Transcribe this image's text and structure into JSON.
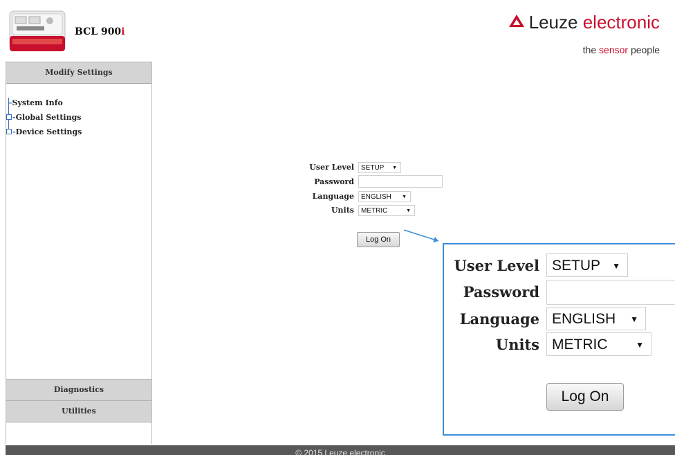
{
  "header": {
    "product_name": "BCL 900",
    "product_slash": "i",
    "device_image": "device-image",
    "brand_name": "Leuze",
    "brand_accent": "electronic",
    "tagline_pre": "the ",
    "tagline_accent": "sensor",
    "tagline_post": " people",
    "brand_color": "#c8102e"
  },
  "sidebar": {
    "modify_settings": "Modify Settings",
    "tree": [
      {
        "label": "System Info"
      },
      {
        "label": "Global Settings"
      },
      {
        "label": "Device Settings"
      }
    ],
    "diagnostics": "Diagnostics",
    "utilities": "Utilities"
  },
  "login": {
    "user_level_label": "User Level",
    "user_level_value": "SETUP",
    "password_label": "Password",
    "password_value": "",
    "language_label": "Language",
    "language_value": "ENGLISH",
    "units_label": "Units",
    "units_value": "METRIC",
    "logon_label": "Log On"
  },
  "zoom": {
    "user_level_label": "User Level",
    "user_level_value": "SETUP",
    "password_label": "Password",
    "language_label": "Language",
    "language_value": "ENGLISH",
    "units_label": "Units",
    "units_value": "METRIC",
    "logon_label": "Log On",
    "border_color": "#3d8ed8"
  },
  "footer": {
    "copyright": "© 2015 Leuze electronic"
  }
}
